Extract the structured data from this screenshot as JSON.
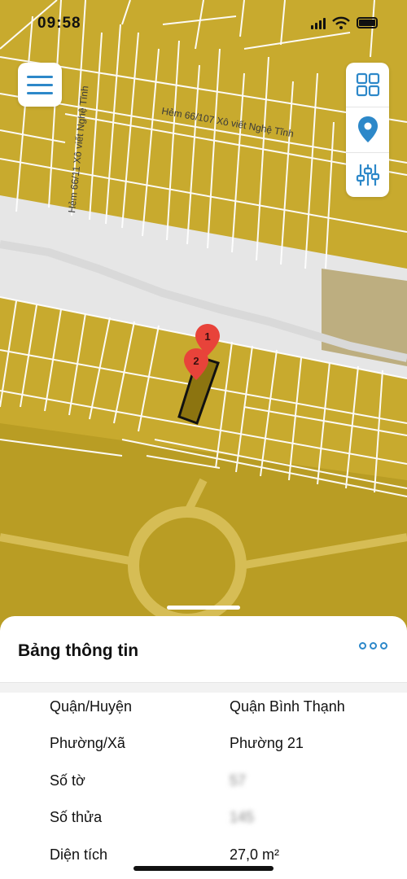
{
  "status_bar": {
    "time": "09:58"
  },
  "map": {
    "street_label_1": "Hẻm 66/107 Xô viết Nghệ Tĩnh",
    "street_label_2": "Hẻm 66/11 Xô viết Nghệ Tĩnh",
    "marker_1": "1",
    "marker_2": "2",
    "colors": {
      "land": "#c8aa2e",
      "land_dark": "#b99d24",
      "road": "#e6e6e6",
      "parcel_line": "#ffffff",
      "highlight": "#8c7410",
      "marker": "#e8433a"
    }
  },
  "toolbar": {
    "menu_icon": "menu-icon",
    "layers_icon": "grid-icon",
    "location_icon": "location-pin-icon",
    "filter_icon": "sliders-icon"
  },
  "sheet": {
    "title": "Bảng thông tin",
    "more_icon": "more-dots-icon",
    "rows": [
      {
        "label": "Quận/Huyện",
        "value": "Quận Bình Thạnh"
      },
      {
        "label": "Phường/Xã",
        "value": "Phường 21"
      },
      {
        "label": "Số tờ",
        "value": "57"
      },
      {
        "label": "Số thửa",
        "value": "145"
      },
      {
        "label": "Diện tích",
        "value": "27,0 m²"
      }
    ]
  }
}
